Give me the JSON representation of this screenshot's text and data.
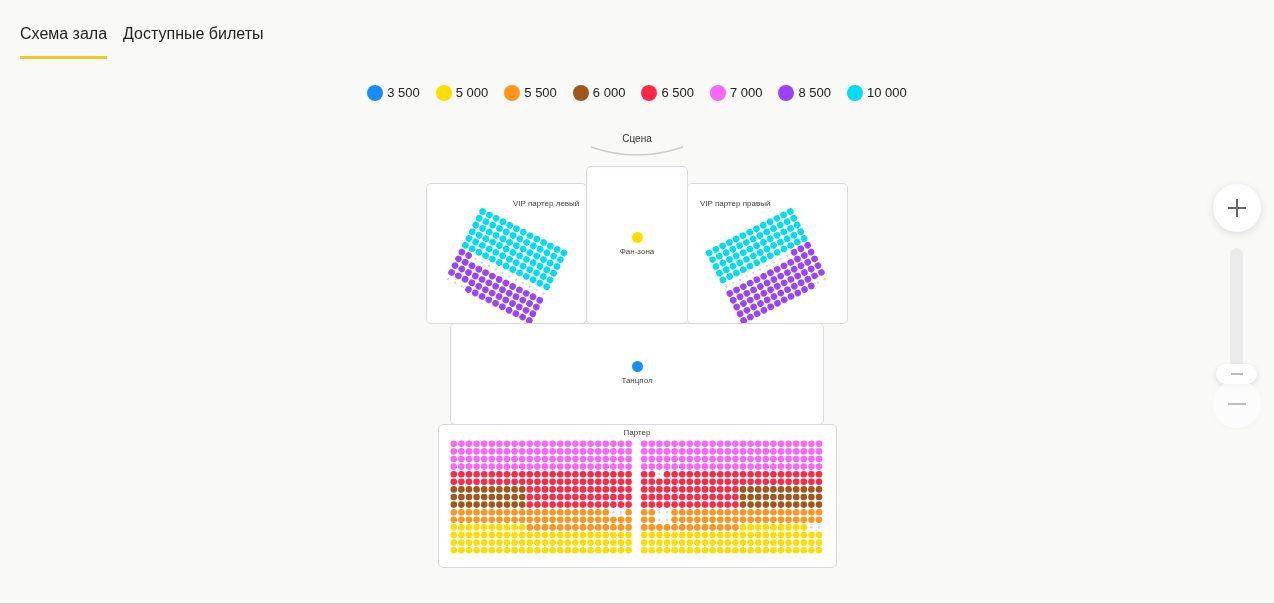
{
  "tabs": [
    {
      "label": "Схема зала",
      "selected": true
    },
    {
      "label": "Доступные билеты",
      "selected": false
    }
  ],
  "legend": [
    {
      "label": "3 500",
      "color": "#1a8cff"
    },
    {
      "label": "5 000",
      "color": "#ffdd00"
    },
    {
      "label": "5 500",
      "color": "#ff951f"
    },
    {
      "label": "6 000",
      "color": "#a3561c"
    },
    {
      "label": "6 500",
      "color": "#ff2846"
    },
    {
      "label": "7 000",
      "color": "#f866fa"
    },
    {
      "label": "8 500",
      "color": "#9c42fa"
    },
    {
      "label": "10 000",
      "color": "#00dcf0"
    }
  ],
  "stage": {
    "label": "Сцена"
  },
  "sections": [
    {
      "kind": "vip-left",
      "title": "VIP партер левый"
    },
    {
      "kind": "standing",
      "title": "Фан-зона",
      "color": "#ffdd00"
    },
    {
      "kind": "vip-right",
      "title": "VIP партер правый"
    },
    {
      "kind": "standing",
      "title": "Танцпол",
      "color": "#1a8cff"
    },
    {
      "kind": "stalls",
      "title": "Партер"
    }
  ],
  "zoom": {
    "level": 0
  }
}
